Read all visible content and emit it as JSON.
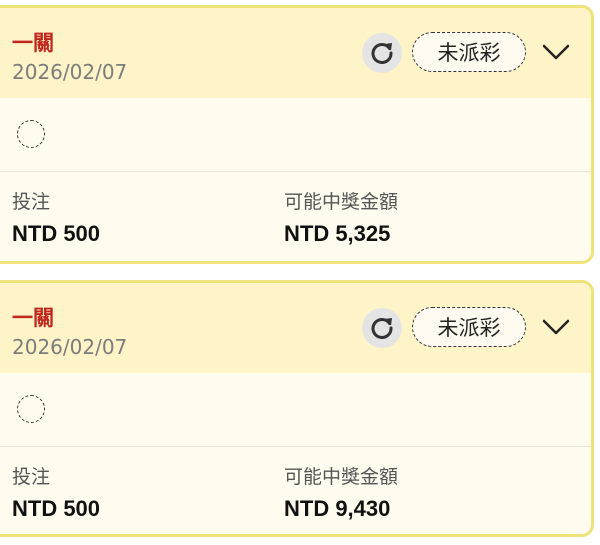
{
  "bets": [
    {
      "title": "一關",
      "date": "2026/02/07",
      "status": "未派彩",
      "refresh_icon": "refresh-icon",
      "expand_icon": "chevron-down-icon",
      "stake_label": "投注",
      "stake_value": "NTD 500",
      "payout_label": "可能中獎金額",
      "payout_value": "NTD 5,325"
    },
    {
      "title": "一關",
      "date": "2026/02/07",
      "status": "未派彩",
      "refresh_icon": "refresh-icon",
      "expand_icon": "chevron-down-icon",
      "stake_label": "投注",
      "stake_value": "NTD 500",
      "payout_label": "可能中獎金額",
      "payout_value": "NTD 9,430"
    }
  ],
  "colors": {
    "title_red": "#c0281e",
    "header_bg": "#fff3c8",
    "body_bg": "#fffcef",
    "border": "#f0e27a"
  }
}
